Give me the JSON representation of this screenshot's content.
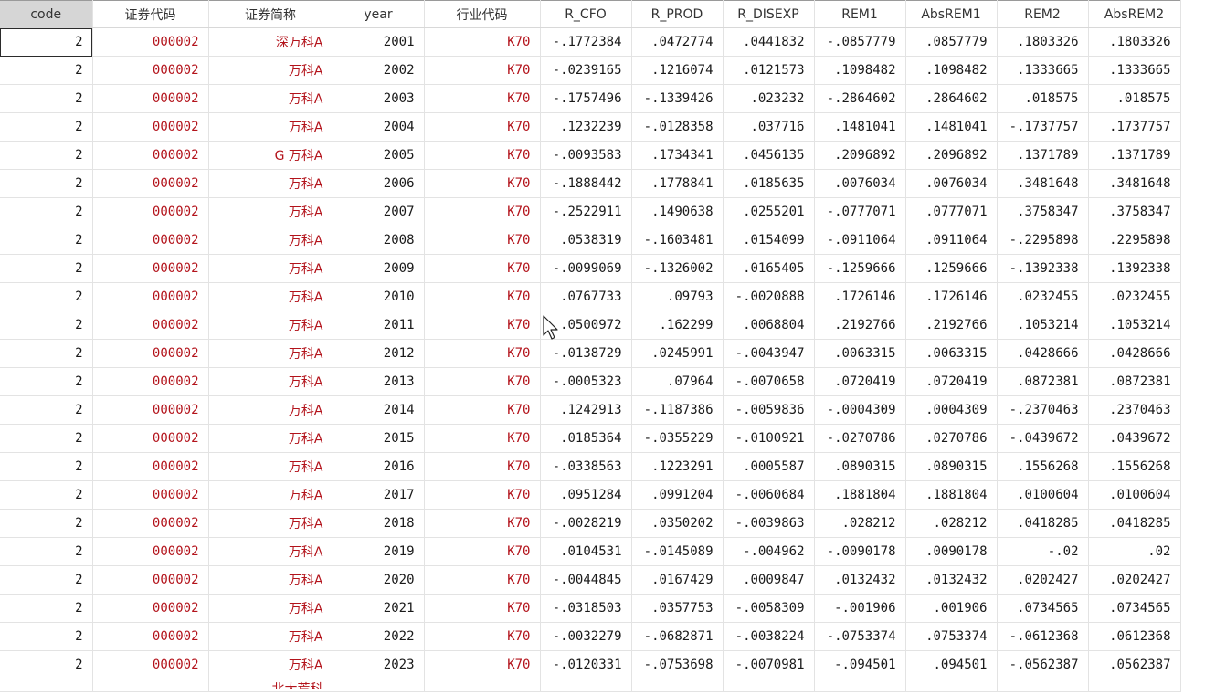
{
  "columns": [
    "code",
    "证券代码",
    "证券简称",
    "year",
    "行业代码",
    "R_CFO",
    "R_PROD",
    "R_DISEXP",
    "REM1",
    "AbsREM1",
    "REM2",
    "AbsREM2"
  ],
  "rows": [
    [
      "2",
      "000002",
      "深万科A",
      "2001",
      "K70",
      "-.1772384",
      ".0472774",
      ".0441832",
      "-.0857779",
      ".0857779",
      ".1803326",
      ".1803326"
    ],
    [
      "2",
      "000002",
      "万科A",
      "2002",
      "K70",
      "-.0239165",
      ".1216074",
      ".0121573",
      ".1098482",
      ".1098482",
      ".1333665",
      ".1333665"
    ],
    [
      "2",
      "000002",
      "万科A",
      "2003",
      "K70",
      "-.1757496",
      "-.1339426",
      ".023232",
      "-.2864602",
      ".2864602",
      ".018575",
      ".018575"
    ],
    [
      "2",
      "000002",
      "万科A",
      "2004",
      "K70",
      ".1232239",
      "-.0128358",
      ".037716",
      ".1481041",
      ".1481041",
      "-.1737757",
      ".1737757"
    ],
    [
      "2",
      "000002",
      "G 万科A",
      "2005",
      "K70",
      "-.0093583",
      ".1734341",
      ".0456135",
      ".2096892",
      ".2096892",
      ".1371789",
      ".1371789"
    ],
    [
      "2",
      "000002",
      "万科A",
      "2006",
      "K70",
      "-.1888442",
      ".1778841",
      ".0185635",
      ".0076034",
      ".0076034",
      ".3481648",
      ".3481648"
    ],
    [
      "2",
      "000002",
      "万科A",
      "2007",
      "K70",
      "-.2522911",
      ".1490638",
      ".0255201",
      "-.0777071",
      ".0777071",
      ".3758347",
      ".3758347"
    ],
    [
      "2",
      "000002",
      "万科A",
      "2008",
      "K70",
      ".0538319",
      "-.1603481",
      ".0154099",
      "-.0911064",
      ".0911064",
      "-.2295898",
      ".2295898"
    ],
    [
      "2",
      "000002",
      "万科A",
      "2009",
      "K70",
      "-.0099069",
      "-.1326002",
      ".0165405",
      "-.1259666",
      ".1259666",
      "-.1392338",
      ".1392338"
    ],
    [
      "2",
      "000002",
      "万科A",
      "2010",
      "K70",
      ".0767733",
      ".09793",
      "-.0020888",
      ".1726146",
      ".1726146",
      ".0232455",
      ".0232455"
    ],
    [
      "2",
      "000002",
      "万科A",
      "2011",
      "K70",
      ".0500972",
      ".162299",
      ".0068804",
      ".2192766",
      ".2192766",
      ".1053214",
      ".1053214"
    ],
    [
      "2",
      "000002",
      "万科A",
      "2012",
      "K70",
      "-.0138729",
      ".0245991",
      "-.0043947",
      ".0063315",
      ".0063315",
      ".0428666",
      ".0428666"
    ],
    [
      "2",
      "000002",
      "万科A",
      "2013",
      "K70",
      "-.0005323",
      ".07964",
      "-.0070658",
      ".0720419",
      ".0720419",
      ".0872381",
      ".0872381"
    ],
    [
      "2",
      "000002",
      "万科A",
      "2014",
      "K70",
      ".1242913",
      "-.1187386",
      "-.0059836",
      "-.0004309",
      ".0004309",
      "-.2370463",
      ".2370463"
    ],
    [
      "2",
      "000002",
      "万科A",
      "2015",
      "K70",
      ".0185364",
      "-.0355229",
      "-.0100921",
      "-.0270786",
      ".0270786",
      "-.0439672",
      ".0439672"
    ],
    [
      "2",
      "000002",
      "万科A",
      "2016",
      "K70",
      "-.0338563",
      ".1223291",
      ".0005587",
      ".0890315",
      ".0890315",
      ".1556268",
      ".1556268"
    ],
    [
      "2",
      "000002",
      "万科A",
      "2017",
      "K70",
      ".0951284",
      ".0991204",
      "-.0060684",
      ".1881804",
      ".1881804",
      ".0100604",
      ".0100604"
    ],
    [
      "2",
      "000002",
      "万科A",
      "2018",
      "K70",
      "-.0028219",
      ".0350202",
      "-.0039863",
      ".028212",
      ".028212",
      ".0418285",
      ".0418285"
    ],
    [
      "2",
      "000002",
      "万科A",
      "2019",
      "K70",
      ".0104531",
      "-.0145089",
      "-.004962",
      "-.0090178",
      ".0090178",
      "-.02",
      ".02"
    ],
    [
      "2",
      "000002",
      "万科A",
      "2020",
      "K70",
      "-.0044845",
      ".0167429",
      ".0009847",
      ".0132432",
      ".0132432",
      ".0202427",
      ".0202427"
    ],
    [
      "2",
      "000002",
      "万科A",
      "2021",
      "K70",
      "-.0318503",
      ".0357753",
      "-.0058309",
      "-.001906",
      ".001906",
      ".0734565",
      ".0734565"
    ],
    [
      "2",
      "000002",
      "万科A",
      "2022",
      "K70",
      "-.0032279",
      "-.0682871",
      "-.0038224",
      "-.0753374",
      ".0753374",
      "-.0612368",
      ".0612368"
    ],
    [
      "2",
      "000002",
      "万科A",
      "2023",
      "K70",
      "-.0120331",
      "-.0753698",
      "-.0070981",
      "-.094501",
      ".094501",
      "-.0562387",
      ".0562387"
    ]
  ],
  "partial_row": [
    "",
    "",
    "北大荒科",
    "",
    "",
    "",
    "",
    "",
    "",
    "",
    "",
    ""
  ],
  "colors": {
    "string_text": "#b3131b",
    "numeric_text": "#1a1a1a",
    "header_selected_bg": "#d6d6d6",
    "grid_line": "#e3e3e3"
  },
  "cursor_icon": "arrow-pointer-icon"
}
